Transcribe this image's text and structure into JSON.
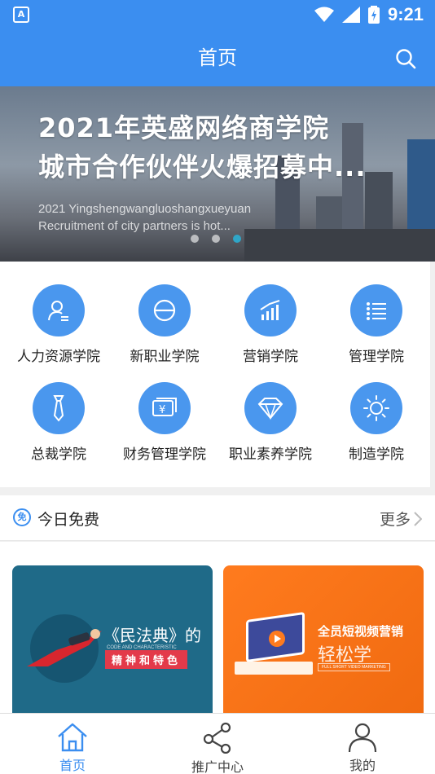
{
  "status_bar": {
    "time": "9:21"
  },
  "header": {
    "title": "首页"
  },
  "banner": {
    "headline_line1": "2021年英盛网络商学院",
    "headline_line2": "城市合作伙伴火爆招募中...",
    "english_line1": "2021 Yingshengwangluoshangxueyuan",
    "english_line2": "Recruitment of city partners is hot...",
    "active_dot": 3
  },
  "categories": [
    {
      "label": "人力资源学院",
      "icon": "hr-person-icon"
    },
    {
      "label": "新职业学院",
      "icon": "new-career-icon"
    },
    {
      "label": "营销学院",
      "icon": "marketing-chart-icon"
    },
    {
      "label": "管理学院",
      "icon": "management-list-icon"
    },
    {
      "label": "总裁学院",
      "icon": "tie-icon"
    },
    {
      "label": "财务管理学院",
      "icon": "finance-yen-icon"
    },
    {
      "label": "职业素养学院",
      "icon": "diamond-icon"
    },
    {
      "label": "制造学院",
      "icon": "sun-gear-icon"
    }
  ],
  "free_today": {
    "badge": "免",
    "title": "今日免费",
    "more_label": "更多",
    "courses": [
      {
        "title": "《民法典》的",
        "subtitle": "CODE AND CHARACTERISTIC",
        "tag": "精神和特色"
      },
      {
        "title": "全员短视频营销",
        "title2": "轻松学",
        "subtitle": "FULL SHORT VIDEO MARKETING"
      }
    ]
  },
  "tabs": [
    {
      "label": "首页",
      "icon": "home-icon",
      "active": true
    },
    {
      "label": "推广中心",
      "icon": "share-icon",
      "active": false
    },
    {
      "label": "我的",
      "icon": "profile-icon",
      "active": false
    }
  ],
  "colors": {
    "primary": "#3b8ef0",
    "category_circle": "#4a97ee",
    "course_blue": "#1f6a88",
    "course_orange": "#ff7b1e"
  }
}
